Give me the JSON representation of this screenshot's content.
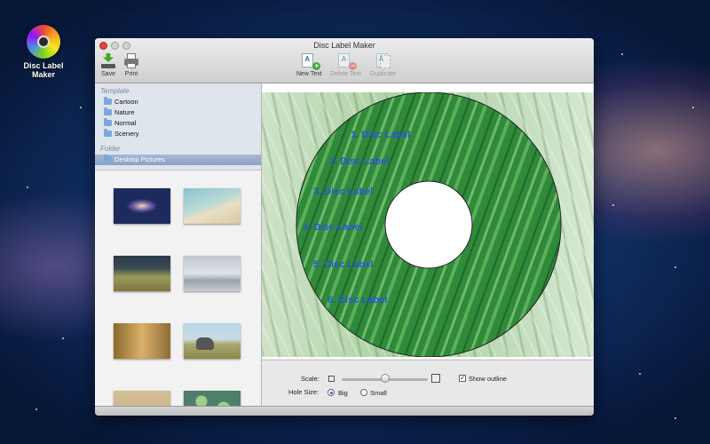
{
  "desktop": {
    "icon_label_line1": "Disc Label",
    "icon_label_line2": "Maker"
  },
  "window": {
    "title": "Disc Label Maker"
  },
  "toolbar": {
    "save": "Save",
    "print": "Print",
    "new_text": "New Text",
    "delete_text": "Delete Text",
    "duplicate": "Duplicate"
  },
  "sidebar": {
    "template_header": "Template",
    "templates": [
      "Cartoon",
      "Nature",
      "Normal",
      "Scenery"
    ],
    "folder_header": "Folder",
    "folders": [
      "Desktop Pictures"
    ]
  },
  "disc_labels": [
    "1. Disc Label",
    "2. Disc Label",
    "3. Disc Label",
    "4. Disc Label",
    "5. Disc Label",
    "6. Disc Label"
  ],
  "controls": {
    "scale_label": "Scale:",
    "scale_value": 0.5,
    "show_outline_label": "Show outline",
    "show_outline_checked": true,
    "hole_size_label": "Hole Size:",
    "hole_big": "Big",
    "hole_small": "Small",
    "hole_selected": "Big"
  },
  "colors": {
    "label_text": "#2a56d6",
    "disc_green": "#2f8a3a"
  }
}
